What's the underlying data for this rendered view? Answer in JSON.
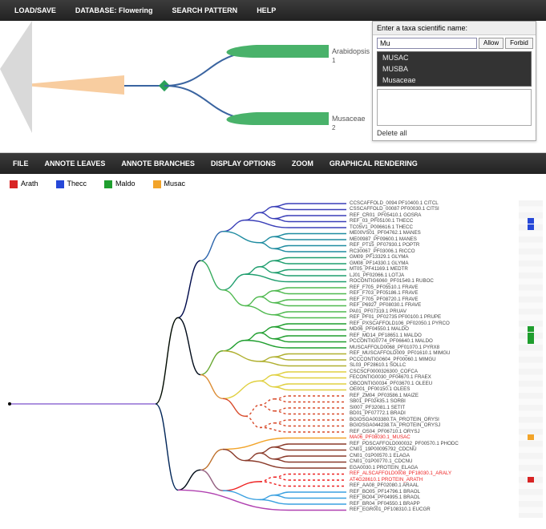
{
  "topbar": {
    "items": [
      "LOAD/SAVE",
      "DATABASE: Flowering",
      "SEARCH PATTERN",
      "HELP"
    ]
  },
  "pattern": {
    "leaf1": "Arabidopsis",
    "leaf2": "Musaceae",
    "num1": "1",
    "num2": "2"
  },
  "taxa_panel": {
    "header": "Enter a taxa scientific name:",
    "input_value": "Mu",
    "allow": "Allow",
    "forbid": "Forbid",
    "suggest": [
      "MUSAC",
      "MUSBA",
      "Musaceae"
    ],
    "delete_all": "Delete all"
  },
  "bar2": {
    "items": [
      "FILE",
      "ANNOTE LEAVES",
      "ANNOTE BRANCHES",
      "DISPLAY OPTIONS",
      "ZOOM",
      "GRAPHICAL RENDERING"
    ]
  },
  "legend": {
    "items": [
      {
        "color": "red",
        "label": "Arath"
      },
      {
        "color": "blue",
        "label": "Thecc"
      },
      {
        "color": "green",
        "label": "Maldo"
      },
      {
        "color": "orange",
        "label": "Musac"
      }
    ]
  },
  "tree": {
    "leaves": [
      {
        "label": "CCSCAFFOLD_0094 PF10400.1 CITCL"
      },
      {
        "label": "CSSCAFFOLD_00087 PF00030.1 CITSI"
      },
      {
        "label": "REF_CR01_PF05410.1 GOSRA"
      },
      {
        "label": "REF_03_PF05100.1 THECC"
      },
      {
        "label": "TC05V1_P006616.1 THECC"
      },
      {
        "label": "ME00VS01_PF04762.1 MANES"
      },
      {
        "label": "ME00987_PF09600.1 MANES"
      },
      {
        "label": "REF_PT15_PF07930.1 POPTR"
      },
      {
        "label": "RC30067_PF03006.1 RICCO"
      },
      {
        "label": "GM09_PF13329.1 GLYMA"
      },
      {
        "label": "GM08_PF14330.1 GLYMA"
      },
      {
        "label": "MT05_PF41169.1 MEDTR"
      },
      {
        "label": "LJ01_PF02066.1 LOTJA"
      },
      {
        "label": "ROCONTIG6060_PF01549.1 RUBOC"
      },
      {
        "label": "REF_F705_PF05510.1 FRAVE"
      },
      {
        "label": "REF_F703_PF05186.1 FRAVE"
      },
      {
        "label": "REF_F705_PF08720.1 FRAVE"
      },
      {
        "label": "REF_P6927_PF08030.1 FRAVE"
      },
      {
        "label": "PA01_PF07319.1 PRUAV"
      },
      {
        "label": "REF_PF01_PF02735 PF00100.1 PRUPE"
      },
      {
        "label": "REF_PXSCAFFOLD106_PF02050.1 PYRCO"
      },
      {
        "label": "MD06_PF04550.1 MALDO"
      },
      {
        "label": "REF_MD14_PF18651.1 MALDO"
      },
      {
        "label": "PCCONTIG0774_PF06640.1 MALDO"
      },
      {
        "label": "MUSCAFFOLD0068_PF01070.1 PYRX8"
      },
      {
        "label": "REF_MUSCAFFOLD009_PF01610.1 MIMGU"
      },
      {
        "label": "PCCCONTIG0604_PF00060.1 MIMGU"
      },
      {
        "label": "SL03_PF28610.1 SOLLC"
      },
      {
        "label": "CSCSCF0000326300_COFCA"
      },
      {
        "label": "FECONTIG0030_PF04670.1 FRAEX"
      },
      {
        "label": "OBCONTIG0034_PF03670.1 OLEEU"
      },
      {
        "label": "OE001_PF00150.1 OLEES"
      },
      {
        "label": "REF_ZM04_PF03586.1 MAIZE"
      },
      {
        "label": "SB01_PF02435.1 SORBI"
      },
      {
        "label": "SI007_PF32081.1 SETIT"
      },
      {
        "label": "BD01_PF07772.1 BRADI"
      },
      {
        "label": "BGIOSGA003380.TA_PROTEIN_ORYSI"
      },
      {
        "label": "BGIOSGA044238.TA_PROTEIN_ORYSJ"
      },
      {
        "label": "REF_OS04_PF06710.1 ORYSJ"
      },
      {
        "label": "MA06_PF08030.1_MUSAC",
        "hilite": true
      },
      {
        "label": "REF_PDSCAFFOLD000032_PF00570.1 PHODC"
      },
      {
        "label": "CN01_19P00095792_CDCNU"
      },
      {
        "label": "CN01_01P00570.1 ELAGA"
      },
      {
        "label": "CN01_01P00770.1_CDCNU"
      },
      {
        "label": "EGA0030.1 PROTEIN_ELAGA"
      },
      {
        "label": "REF_ALSCAFFOLD0008_PF18030.1_ARALY",
        "hilite": true
      },
      {
        "label": "AT4G28610.1 PROTEIN_ARATH",
        "hilite": true
      },
      {
        "label": "REF_AA08_PF02080.1 ARAAL"
      },
      {
        "label": "REF_BO05_PF14796.1 BRAOL"
      },
      {
        "label": "REF_BO04_PF04995.1 BRAOL"
      },
      {
        "label": "REF_BR04_PF04550.1 BRAPP"
      },
      {
        "label": "REF_EGR001_PF108310.1 EUCGR"
      }
    ],
    "markers": [
      {
        "row": 3,
        "color": "#2648d8"
      },
      {
        "row": 4,
        "color": "#2648d8"
      },
      {
        "row": 21,
        "color": "#1f9e2e"
      },
      {
        "row": 22,
        "color": "#1f9e2e"
      },
      {
        "row": 23,
        "color": "#1f9e2e"
      },
      {
        "row": 39,
        "color": "#f2a42a"
      },
      {
        "row": 46,
        "color": "#d82424"
      }
    ]
  }
}
